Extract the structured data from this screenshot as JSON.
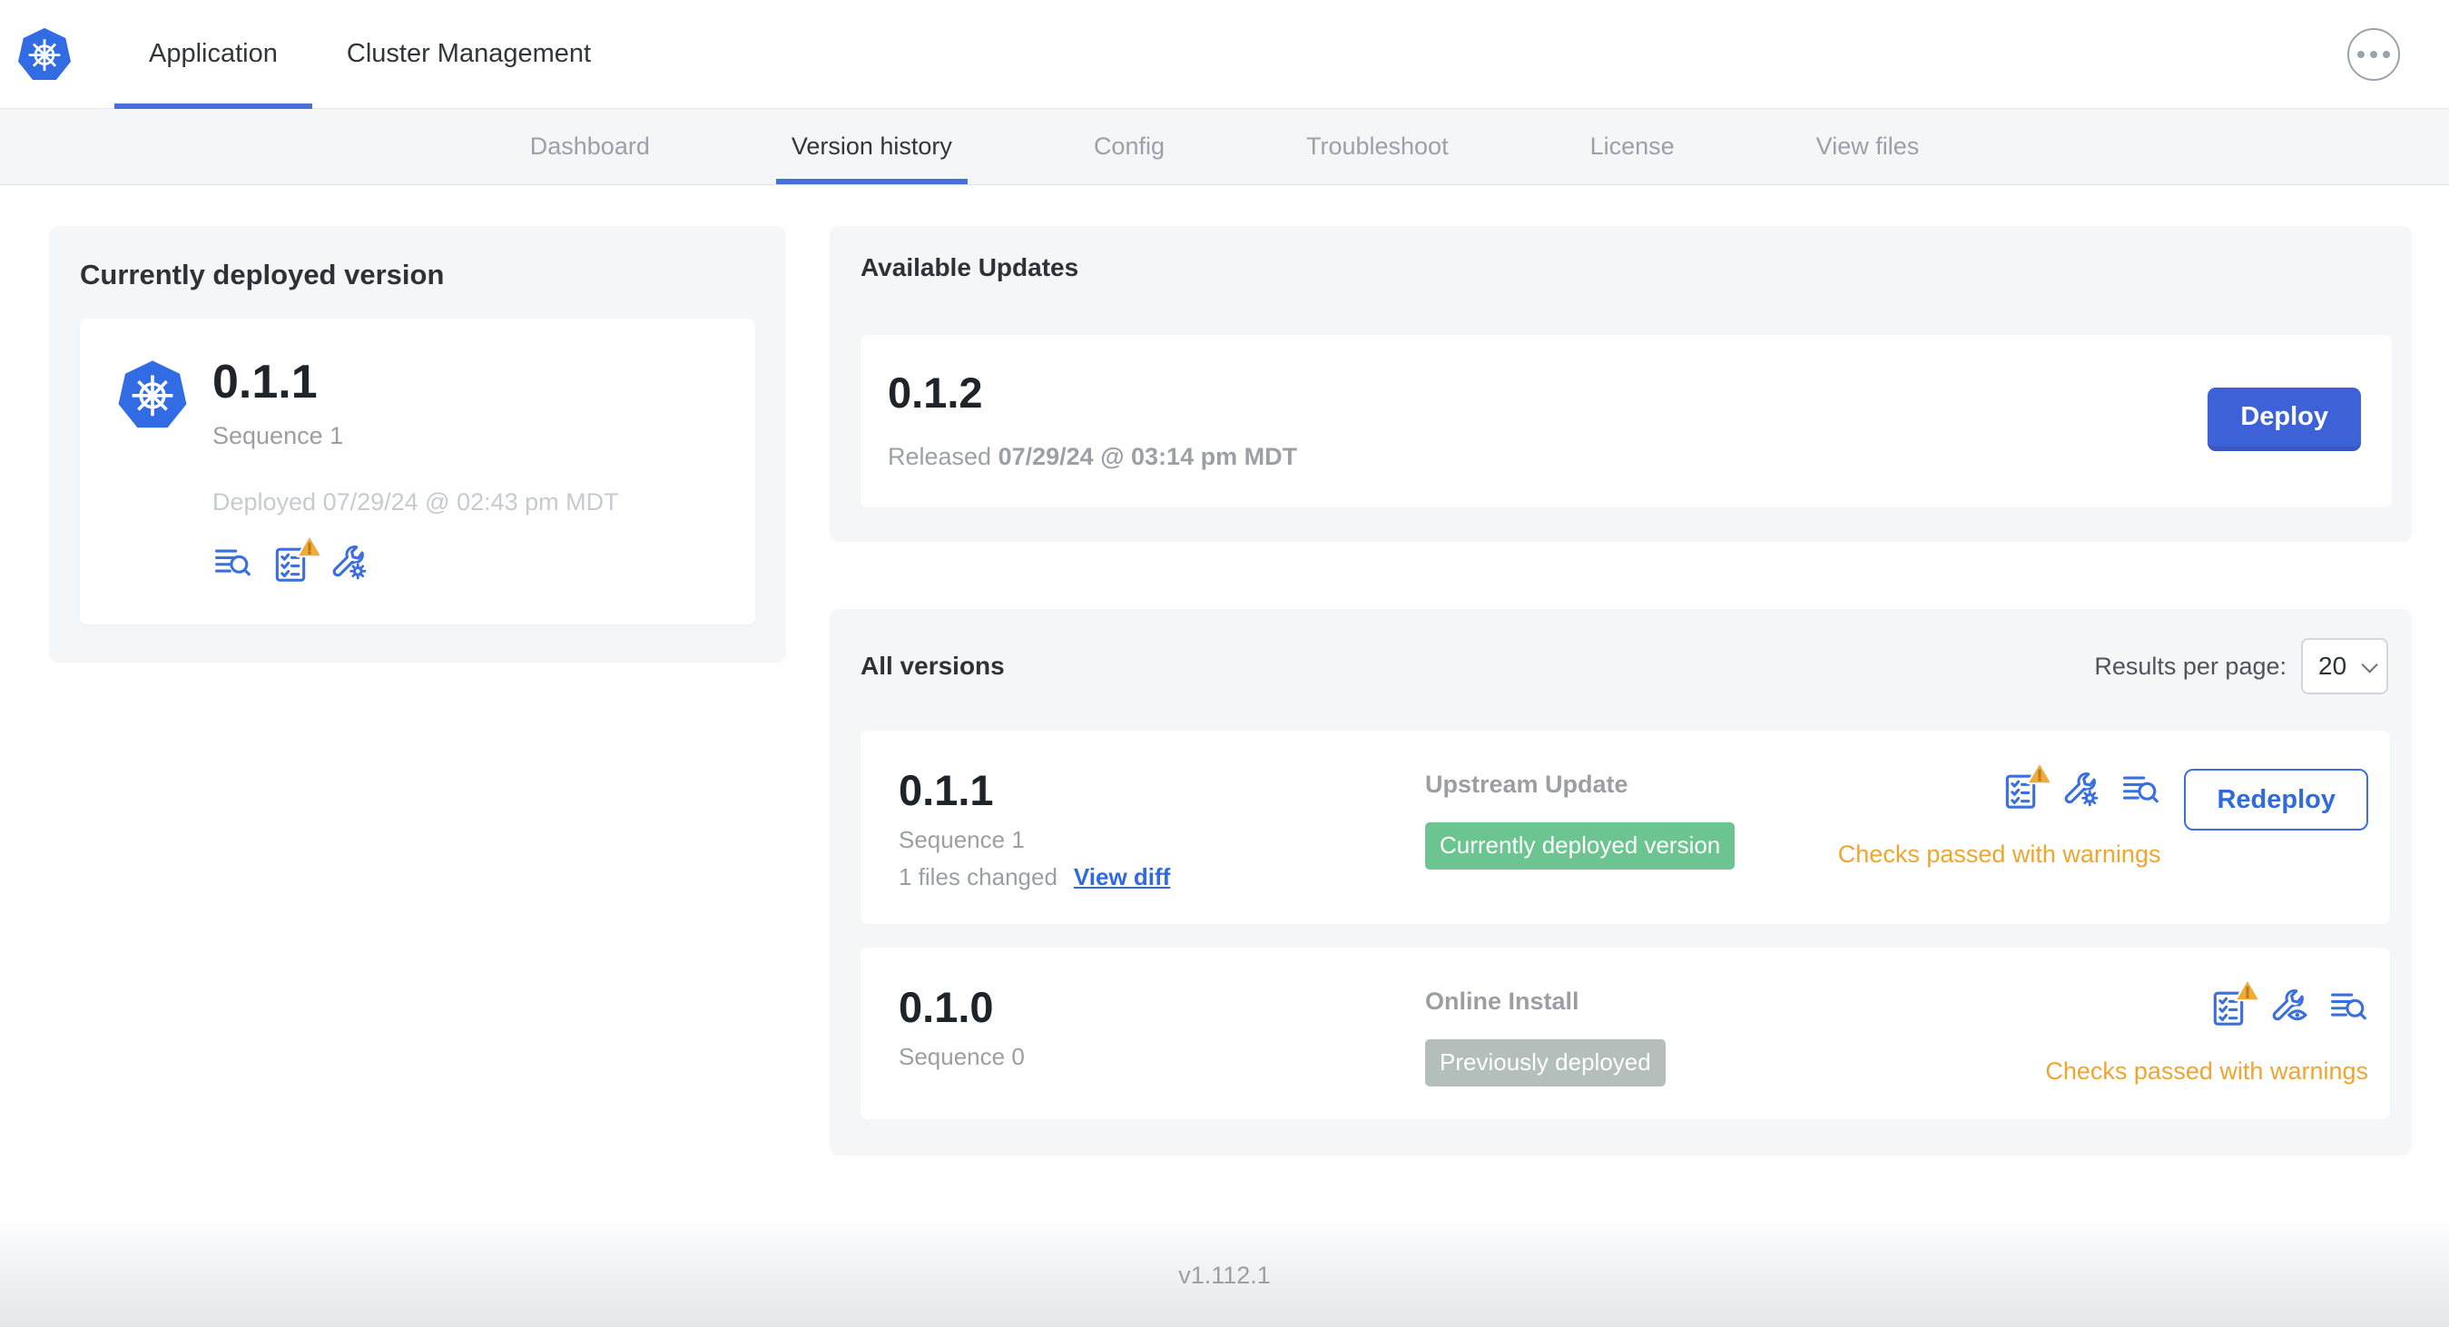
{
  "header": {
    "tabs": [
      {
        "label": "Application"
      },
      {
        "label": "Cluster Management"
      }
    ]
  },
  "subnav": {
    "tabs": [
      "Dashboard",
      "Version history",
      "Config",
      "Troubleshoot",
      "License",
      "View files"
    ]
  },
  "current_version": {
    "card_title": "Currently deployed version",
    "version": "0.1.1",
    "sequence": "Sequence 1",
    "deployed_at": "Deployed 07/29/24 @ 02:43 pm MDT",
    "icons": [
      "logs-icon",
      "preflight-checks-warning-icon",
      "edit-config-icon"
    ]
  },
  "available_updates": {
    "card_title": "Available Updates",
    "version": "0.1.2",
    "released_label": "Released",
    "released_at": "07/29/24 @ 03:14 pm MDT",
    "deploy_button": "Deploy"
  },
  "all_versions": {
    "card_title": "All versions",
    "results_per_page_label": "Results per page:",
    "results_per_page": "20",
    "rows": [
      {
        "version": "0.1.1",
        "sequence": "Sequence 1",
        "files_changed": "1 files changed",
        "view_diff_link": "View diff",
        "source": "Upstream Update",
        "status_badge": "Currently deployed version",
        "badge_color": "green",
        "checks_status": "Checks passed with warnings",
        "action_button": "Redeploy",
        "icons": [
          "preflight-checks-warning-icon",
          "edit-config-icon",
          "logs-icon"
        ]
      },
      {
        "version": "0.1.0",
        "sequence": "Sequence 0",
        "source": "Online Install",
        "status_badge": "Previously deployed",
        "badge_color": "gray",
        "checks_status": "Checks passed with warnings",
        "icons": [
          "preflight-checks-warning-icon",
          "view-config-icon",
          "logs-icon"
        ]
      }
    ]
  },
  "footer": {
    "version_label": "v1.112.1"
  },
  "colors": {
    "accent_blue": "#4471de",
    "icon_blue": "#3b6fdd",
    "button_blue": "#3d62d8",
    "badge_green": "#6cc591",
    "badge_gray": "#b4beba",
    "warning_amber": "#f0ab38",
    "warning_text": "#efa52f",
    "k8s_logo_blue": "#326ce5",
    "card_background": "#f5f6f8"
  }
}
